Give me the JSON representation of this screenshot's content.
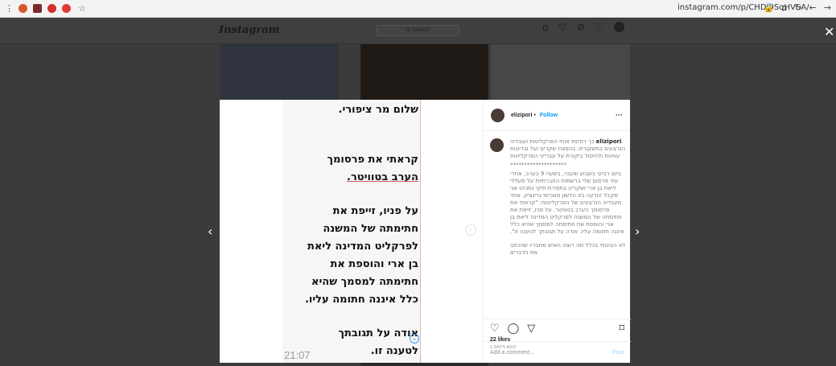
{
  "browser": {
    "url": "instagram.com/p/CHDI9SqHVSA/",
    "menu_icon": "⋮",
    "bookmark_icon": "☆",
    "ext_colors": [
      "#e25b2b",
      "#c23a2b",
      "#d8342a",
      "#e53935"
    ]
  },
  "instagram": {
    "logo": "Instagram",
    "search_placeholder": "Q Search"
  },
  "post": {
    "username": "elizipori",
    "follow_label": "Follow",
    "separator": "•",
    "more_label": "···",
    "image_lines": [
      "שלום מר ציפורי.",
      "קראתי את פרסומך",
      "הערב בטוויטר.",
      "על פניו, זייפת את",
      "חתימתה של המשנה",
      "לפרקליט המדינה ליאת",
      "בן ארי והוספת את",
      "חתימתה למסמך שהיא",
      "כלל איננה חתומה עליו.",
      "אודה על תגובתך",
      "לטענה זו."
    ],
    "image_time": "21:07",
    "caption_paragraphs": [
      "כך רודפת אותי הפרקליטות ועובדיה הנרצעים בתשקורת: בהפצת שקרים ועל ובדיונות עוויטת ולחיסול ביקורת על עברייני הפרקליטות",
      "********************",
      "ביום רביעי בשבוע שעבר, בשעה 9 בערב, אחרי עוד פרסום שלי ברשתות החברתיות על מעללי ליאת בן ארי ושקריה בתפירת תיקי נתניהו אני מקבל הודעה בזו הלשון מאכישי גרינצייג, אחד מעבדיה הנרצעים של הפרקליטות: \"קראתי את פרסומך הערב בטוויטר. על פניו, זייפת את חתימתה של המשנה לפרקליט המדינה ליאת בן ארי והוספת את חתימתה למסמך שהיא כלל איננה חתומה עליו. אודה על תגובתך לטענה זו\".",
      "לא הבינותי בכלל מה רוצה האיש מחבריו שהכתב את הדברים"
    ],
    "likes": "22 likes",
    "ago": "6 DAYS AGO",
    "comment_placeholder": "Add a comment...",
    "post_label": "Post"
  }
}
